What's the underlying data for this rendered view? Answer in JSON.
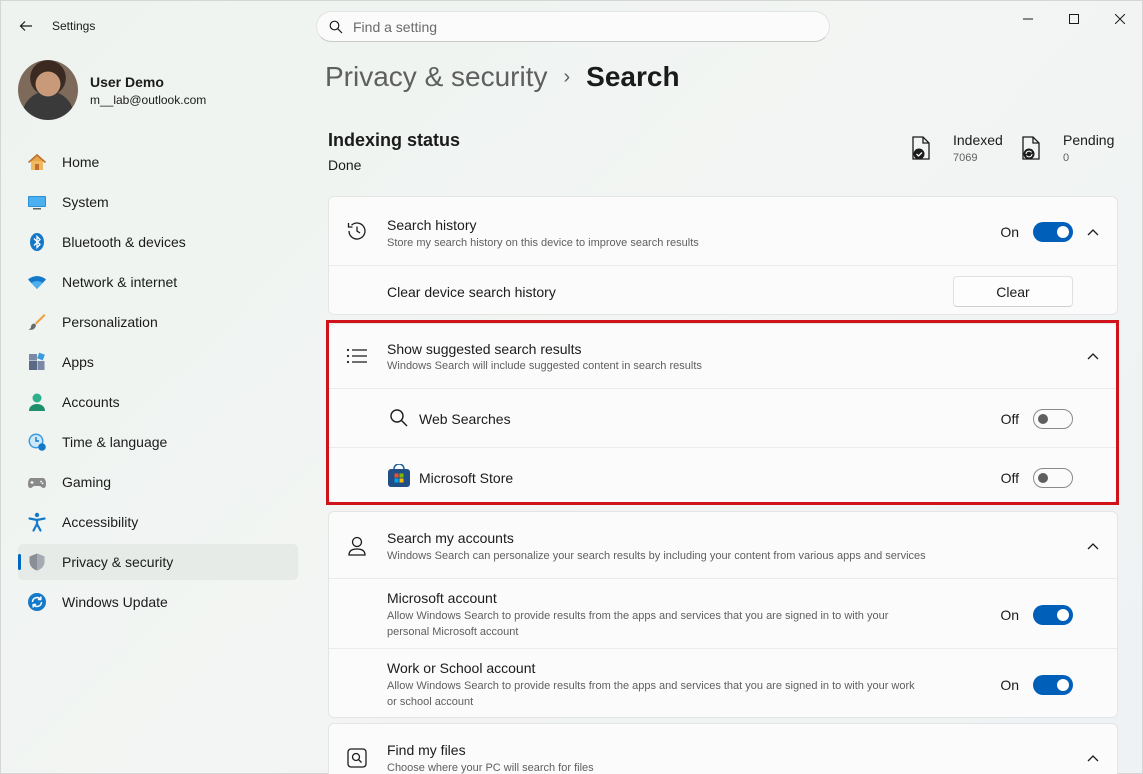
{
  "app": {
    "title": "Settings"
  },
  "search": {
    "placeholder": "Find a setting"
  },
  "user": {
    "name": "User Demo",
    "email": "m__lab@outlook.com"
  },
  "sidebar": {
    "items": [
      {
        "label": "Home",
        "icon": "home-icon"
      },
      {
        "label": "System",
        "icon": "system-icon"
      },
      {
        "label": "Bluetooth & devices",
        "icon": "bluetooth-icon"
      },
      {
        "label": "Network & internet",
        "icon": "wifi-icon"
      },
      {
        "label": "Personalization",
        "icon": "brush-icon"
      },
      {
        "label": "Apps",
        "icon": "apps-icon"
      },
      {
        "label": "Accounts",
        "icon": "accounts-icon"
      },
      {
        "label": "Time & language",
        "icon": "clock-globe-icon"
      },
      {
        "label": "Gaming",
        "icon": "gamepad-icon"
      },
      {
        "label": "Accessibility",
        "icon": "accessibility-icon"
      },
      {
        "label": "Privacy & security",
        "icon": "shield-icon",
        "selected": true
      },
      {
        "label": "Windows Update",
        "icon": "update-icon"
      }
    ]
  },
  "breadcrumb": {
    "parent": "Privacy & security",
    "separator": "›",
    "current": "Search"
  },
  "indexing": {
    "title": "Indexing status",
    "status": "Done",
    "indexed_label": "Indexed",
    "indexed_value": "7069",
    "pending_label": "Pending",
    "pending_value": "0"
  },
  "search_history": {
    "title": "Search history",
    "desc": "Store my search history on this device to improve search results",
    "state": "On",
    "clear_label": "Clear device search history",
    "clear_button": "Clear"
  },
  "suggested": {
    "title": "Show suggested search results",
    "desc": "Windows Search will include suggested content in search results",
    "web_label": "Web Searches",
    "web_state": "Off",
    "store_label": "Microsoft Store",
    "store_state": "Off"
  },
  "accounts": {
    "title": "Search my accounts",
    "desc": "Windows Search can personalize your search results by including your content from various apps and services",
    "ms_title": "Microsoft account",
    "ms_desc_1": "Allow Windows Search to provide results from the apps and services that you are signed in to with your",
    "ms_desc_2": "personal Microsoft account",
    "ms_state": "On",
    "work_title": "Work or School account",
    "work_desc_1": "Allow Windows Search to provide results from the apps and services that you are signed in to with your work",
    "work_desc_2": "or school account",
    "work_state": "On"
  },
  "files": {
    "title": "Find my files",
    "desc": "Choose where your PC will search for files"
  },
  "colors": {
    "accent": "#005fb8",
    "highlight": "#d0121b"
  }
}
